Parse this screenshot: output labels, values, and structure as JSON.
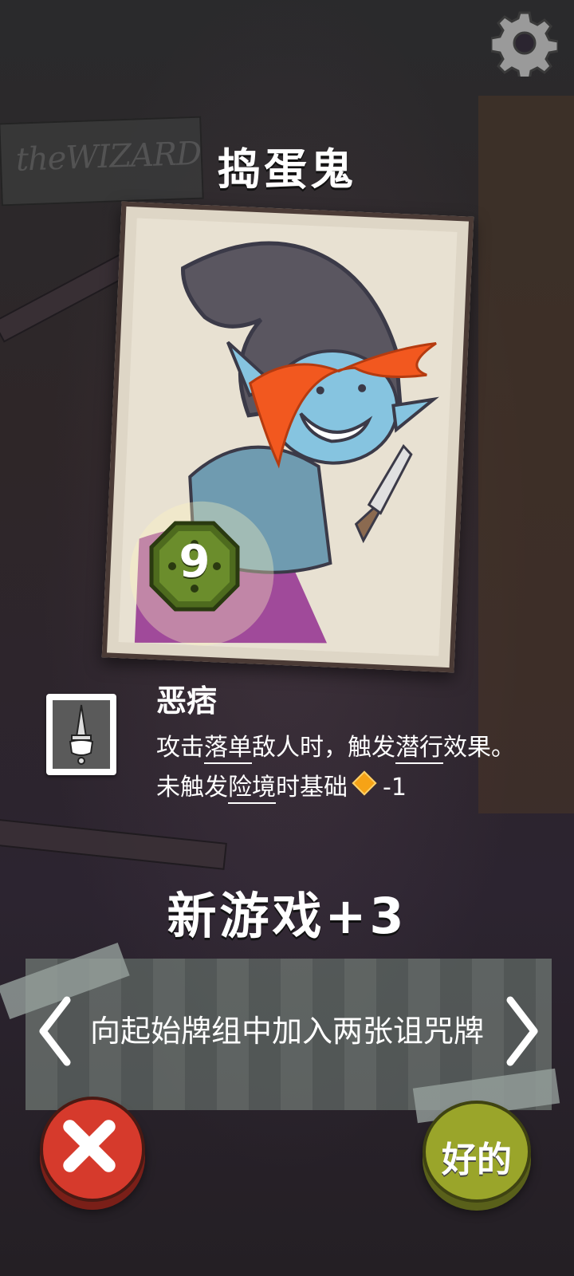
{
  "header": {
    "title": "捣蛋鬼"
  },
  "settings": {
    "icon": "gear-icon"
  },
  "card": {
    "cost": "9",
    "art": "elf-rogue-with-dagger"
  },
  "trait": {
    "icon": "dagger-hand-icon",
    "name": "恶痞",
    "line1_pre": "攻击",
    "line1_kw1": "落单",
    "line1_mid": "敌人时，触发",
    "line1_kw2": "潜行",
    "line1_post": "效果。",
    "line2_pre": "未触发",
    "line2_kw": "险境",
    "line2_mid": "时基础",
    "line2_value": "-1",
    "diamond_color": "#f6a316"
  },
  "new_game": {
    "title": "新游戏+3",
    "description": "向起始牌组中加入两张诅咒牌"
  },
  "buttons": {
    "cancel_icon": "close-icon",
    "ok_label": "好的",
    "cancel_color": "#d63a2c",
    "ok_color": "#9aa52a"
  }
}
